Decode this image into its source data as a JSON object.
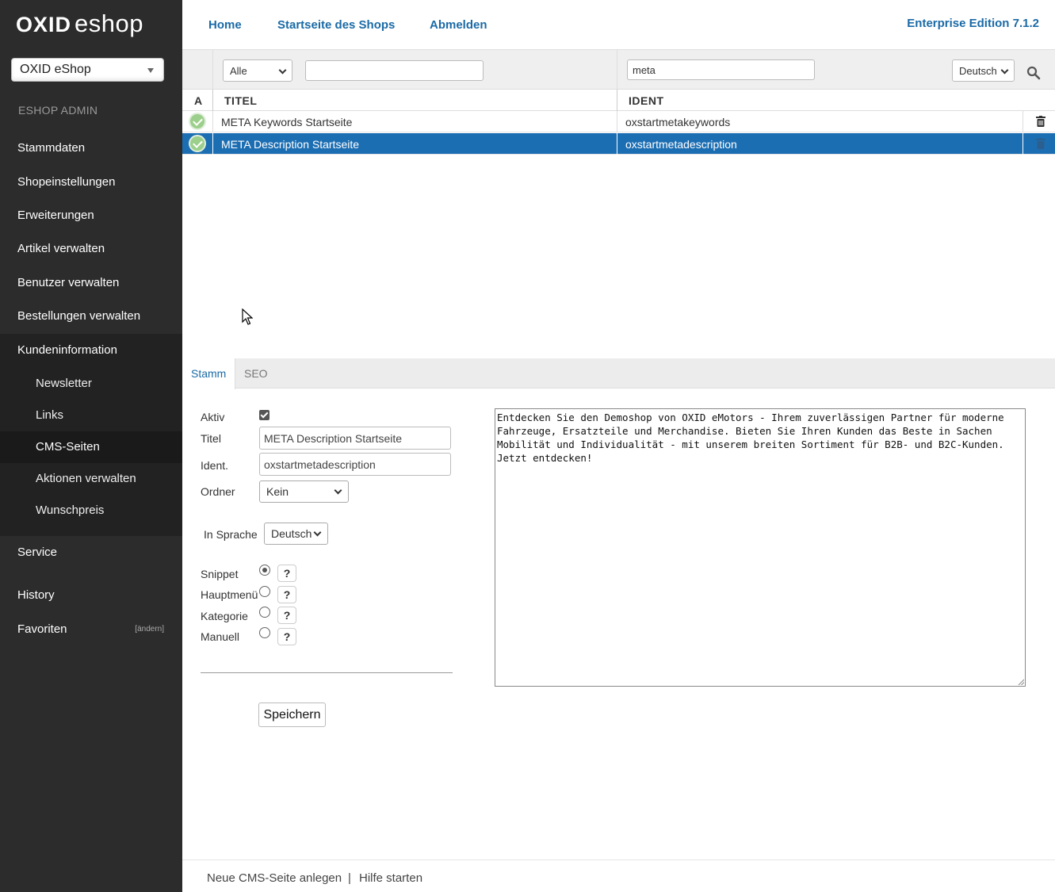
{
  "sidebar": {
    "logo_bold": "OXID",
    "logo_light": "eshop",
    "shop_select_value": "OXID eShop",
    "admin_label": "ESHOP ADMIN",
    "items": [
      {
        "label": "Stammdaten"
      },
      {
        "label": "Shopeinstellungen"
      },
      {
        "label": "Erweiterungen"
      },
      {
        "label": "Artikel verwalten"
      },
      {
        "label": "Benutzer verwalten"
      },
      {
        "label": "Bestellungen verwalten"
      },
      {
        "label": "Kundeninformation"
      },
      {
        "label": "Service"
      },
      {
        "label": "History"
      },
      {
        "label": "Favoriten"
      }
    ],
    "sub_items": [
      {
        "label": "Newsletter"
      },
      {
        "label": "Links"
      },
      {
        "label": "CMS-Seiten"
      },
      {
        "label": "Aktionen verwalten"
      },
      {
        "label": "Wunschpreis"
      }
    ],
    "favoriten_change": "[ändern]"
  },
  "topbar": {
    "links": [
      "Home",
      "Startseite des Shops",
      "Abmelden"
    ],
    "edition": "Enterprise Edition 7.1.2"
  },
  "filter": {
    "folder_select": "Alle",
    "title_filter": "",
    "ident_filter": "meta",
    "language_select": "Deutsch"
  },
  "list": {
    "columns": [
      "A",
      "TITEL",
      "IDENT"
    ],
    "rows": [
      {
        "title": "META Keywords Startseite",
        "ident": "oxstartmetakeywords",
        "active": true,
        "selected": false
      },
      {
        "title": "META Description Startseite",
        "ident": "oxstartmetadescription",
        "active": true,
        "selected": true
      }
    ]
  },
  "tabs": [
    "Stamm",
    "SEO"
  ],
  "form": {
    "aktiv_label": "Aktiv",
    "aktiv_checked": true,
    "titel_label": "Titel",
    "titel_value": "META Description Startseite",
    "ident_label": "Ident.",
    "ident_value": "oxstartmetadescription",
    "ordner_label": "Ordner",
    "ordner_value": "Kein",
    "sprache_label": "In Sprache",
    "sprache_value": "Deutsch",
    "placement": [
      {
        "label": "Snippet",
        "checked": true,
        "help": "?"
      },
      {
        "label": "Hauptmenü",
        "checked": false,
        "help": "?"
      },
      {
        "label": "Kategorie",
        "checked": false,
        "help": "?"
      },
      {
        "label": "Manuell",
        "checked": false,
        "help": "?"
      }
    ],
    "save_label": "Speichern",
    "content": "Entdecken Sie den Demoshop von OXID eMotors - Ihrem zuverlässigen Partner für moderne Fahrzeuge, Ersatzteile und Merchandise. Bieten Sie Ihren Kunden das Beste in Sachen Mobilität und Individualität - mit unserem breiten Sortiment für B2B- und B2C-Kunden. Jetzt entdecken!"
  },
  "footer": {
    "new_link": "Neue CMS-Seite anlegen",
    "separator": "|",
    "help_link": "Hilfe starten"
  },
  "colors": {
    "sidebar_bg": "#2c2c2c",
    "accent": "#1a6aa6",
    "selected_row": "#1c6eb3"
  }
}
